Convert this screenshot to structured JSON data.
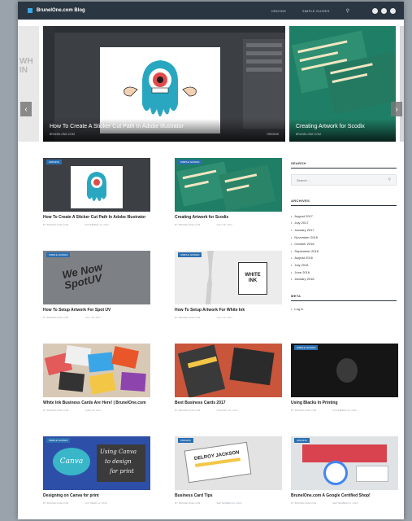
{
  "header": {
    "brand": "BrunelOne.com Blog",
    "nav": [
      "ORIGINS",
      "SIMPLE GUIDES"
    ],
    "search_icon": "search-icon",
    "socials": [
      "social-icon-1",
      "social-icon-2",
      "social-icon-3"
    ]
  },
  "slider": {
    "peek_left_text": "WH\nIN",
    "main": {
      "title": "How To Create A Sticker Cut Path In Adobe Illustrator",
      "meta_left": "BRUNELONE.COM",
      "meta_right": "ORIGINS"
    },
    "second": {
      "title": "Creating Artwork for Scodix",
      "meta_left": "BRUNELONE.COM"
    }
  },
  "posts": [
    {
      "tag": "ORIGINS",
      "title": "How To Create A Sticker Cut Path In Adobe Illustrator",
      "author": "BY BRUNELONE.COM",
      "date": "NOVEMBER 10, 2017"
    },
    {
      "tag": "SIMPLE GUIDES",
      "title": "Creating Artwork for Scodix",
      "author": "BY BRUNELONE.COM",
      "date": "JULY 28, 2017"
    },
    {
      "tag": "SIMPLE GUIDES",
      "title": "How To Setup Artwork For Spot UV",
      "author": "BY BRUNELONE.COM",
      "date": "JULY 28, 2017"
    },
    {
      "tag": "SIMPLE GUIDES",
      "title": "How To Setup Artwork For White Ink",
      "author": "BY BRUNELONE.COM",
      "date": "JULY 21, 2017"
    },
    {
      "tag": "",
      "title": "White Ink Business Cards Are Here! | BrunelOne.com",
      "author": "BY BRUNELONE.COM",
      "date": "JUNE 30, 2017"
    },
    {
      "tag": "",
      "title": "Best Business Cards 2017",
      "author": "BY BRUNELONE.COM",
      "date": "JANUARY 05, 2017"
    },
    {
      "tag": "SIMPLE GUIDES",
      "title": "Using Blacks In Printing",
      "author": "BY BRUNELONE.COM",
      "date": "NOVEMBER 25, 2016"
    },
    {
      "tag": "SIMPLE GUIDES",
      "title": "Designing on Canva for print",
      "author": "BY BRUNELONE.COM",
      "date": "OCTOBER 12, 2016"
    },
    {
      "tag": "ORIGINS",
      "title": "Business Card Tips",
      "author": "BY BRUNELONE.COM",
      "date": "SEPTEMBER 14, 2016"
    },
    {
      "tag": "ORIGINS",
      "title": "BrunelOne.com A Google Certified Shop!",
      "author": "BY BRUNELONE.COM",
      "date": "SEPTEMBER 01, 2016"
    }
  ],
  "canva_lines": [
    "Using Canva",
    "to design",
    "for print"
  ],
  "canva_logo": "Canva",
  "spot_uv_text": "We Now SpotUV",
  "white_ink_text": "WHITE INK",
  "card_name": "DELROY JACKSON",
  "sidebar": {
    "search_title": "SEARCH",
    "search_placeholder": "Search ...",
    "archives_title": "ARCHIVES",
    "archives": [
      "August 2017",
      "July 2017",
      "January 2017",
      "November 2016",
      "October 2016",
      "September 2016",
      "August 2016",
      "July 2016",
      "June 2016",
      "January 2016"
    ],
    "meta_title": "META",
    "meta_items": [
      "Log in"
    ]
  },
  "colors": {
    "topbar": "#2a3642",
    "accent": "#3aa6e8",
    "tag": "#2a6fb0"
  }
}
